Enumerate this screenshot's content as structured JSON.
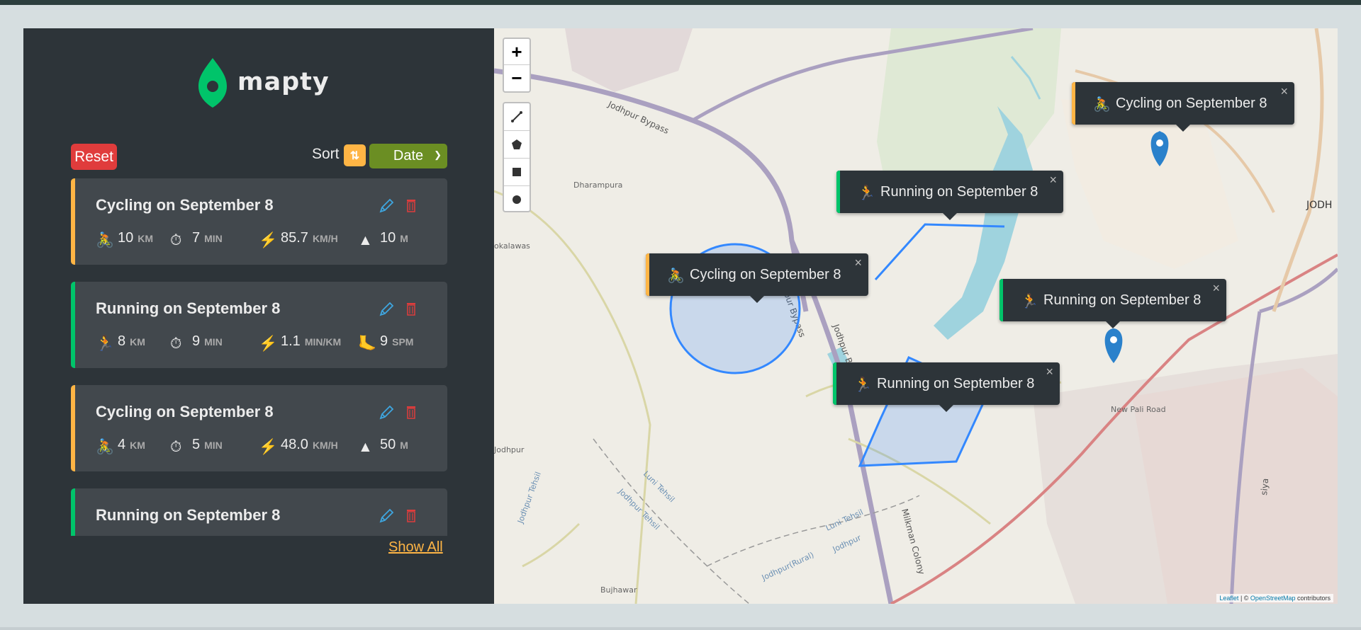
{
  "app": {
    "logo_text": "mapty",
    "brand_color": "#00c46a"
  },
  "controls": {
    "reset_label": "Reset",
    "sort_label": "Sort",
    "sort_toggle_icon": "⇅",
    "sort_value": "Date",
    "show_all_label": "Show All"
  },
  "workouts": [
    {
      "type": "cycling",
      "title": "Cycling on September 8",
      "icon": "cyclist-icon",
      "distance": "10",
      "distance_unit": "KM",
      "duration": "7",
      "duration_unit": "MIN",
      "pace": "85.7",
      "pace_unit": "KM/H",
      "extra": "10",
      "extra_unit": "M",
      "extra_icon": "elevation-icon"
    },
    {
      "type": "running",
      "title": "Running on September 8",
      "icon": "runner-icon",
      "distance": "8",
      "distance_unit": "KM",
      "duration": "9",
      "duration_unit": "MIN",
      "pace": "1.1",
      "pace_unit": "MIN/KM",
      "extra": "9",
      "extra_unit": "SPM",
      "extra_icon": "footprint-icon"
    },
    {
      "type": "cycling",
      "title": "Cycling on September 8",
      "icon": "cyclist-icon",
      "distance": "4",
      "distance_unit": "KM",
      "duration": "5",
      "duration_unit": "MIN",
      "pace": "48.0",
      "pace_unit": "KM/H",
      "extra": "50",
      "extra_unit": "M",
      "extra_icon": "elevation-icon"
    },
    {
      "type": "running",
      "title": "Running on September 8"
    }
  ],
  "map": {
    "zoom_in": "+",
    "zoom_out": "−",
    "popups": [
      {
        "type": "cycling",
        "label": "Cycling on September 8"
      },
      {
        "type": "running",
        "label": "Running on September 8"
      },
      {
        "type": "cycling",
        "label": "Cycling on September 8"
      },
      {
        "type": "running",
        "label": "Running on September 8"
      },
      {
        "type": "running",
        "label": "Running on September 8"
      }
    ],
    "place_labels": [
      "Jodhpur Bypass",
      "Dharampura",
      "okalawas",
      "JODH",
      "Jodhpur Bypass",
      "Jodhpur Bypass",
      "Milkman Colony",
      "New Pali Road",
      "siya",
      "Jodhpur",
      "Jodhpur Tehsil",
      "Luni Tehsil",
      "Jodhpur Tehsil",
      "Luni Tehsil",
      "Jodhpur",
      "Jodhpur(Rural)",
      "Bujhawar"
    ],
    "attribution": {
      "leaflet": "Leaflet",
      "separator": " | © ",
      "osm": "OpenStreetMap",
      "rest": " contributors"
    }
  }
}
